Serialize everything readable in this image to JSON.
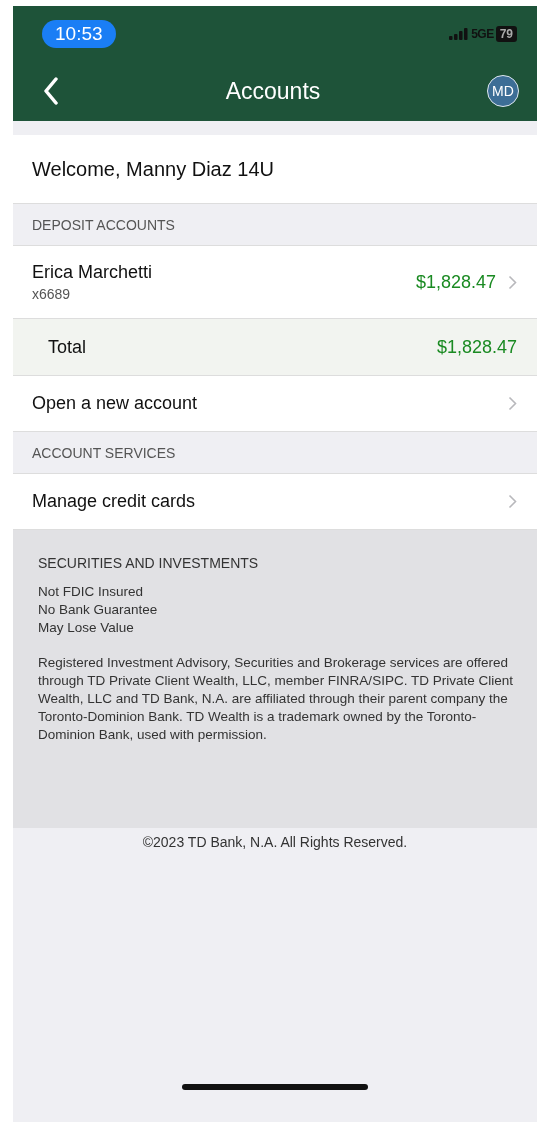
{
  "status_bar": {
    "time": "10:53",
    "network": "5GE",
    "battery": "79"
  },
  "nav": {
    "title": "Accounts",
    "avatar": "MD"
  },
  "welcome": "Welcome, Manny Diaz 14U",
  "sections": [
    {
      "header": "DEPOSIT ACCOUNTS",
      "rows": [
        {
          "kind": "account",
          "name": "Erica Marchetti",
          "number": "x6689",
          "amount": "$1,828.47"
        },
        {
          "kind": "total",
          "name": "Total",
          "amount": "$1,828.47"
        },
        {
          "kind": "link",
          "name": "Open a new account"
        }
      ]
    },
    {
      "header": "ACCOUNT SERVICES",
      "rows": [
        {
          "kind": "link",
          "name": "Manage credit cards"
        }
      ]
    }
  ],
  "securities": {
    "title": "SECURITIES AND INVESTMENTS",
    "notices": [
      "Not FDIC Insured",
      "No Bank Guarantee",
      "May Lose Value"
    ],
    "disclaimer": "Registered Investment Advisory, Securities and Brokerage services are offered through TD Private Client Wealth, LLC, member FINRA/SIPC. TD Private Client Wealth, LLC and TD Bank, N.A. are affiliated through their parent company the Toronto-Dominion Bank. TD Wealth is a trademark owned by the Toronto-Dominion Bank, used with permission."
  },
  "copyright": "©2023 TD Bank, N.A. All Rights Reserved."
}
